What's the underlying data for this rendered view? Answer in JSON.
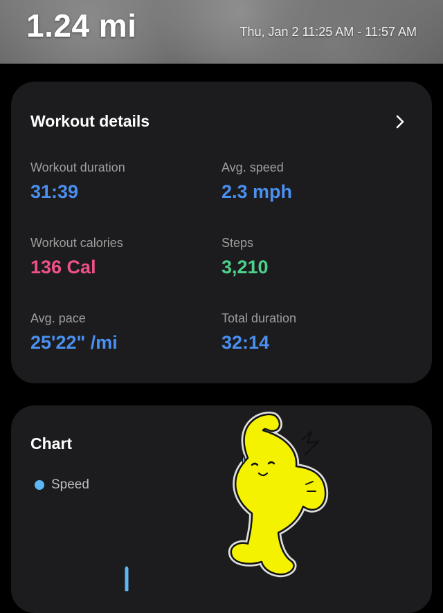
{
  "header": {
    "distance": "1.24 mi",
    "datetime": "Thu, Jan 2 11:25 AM - 11:57 AM"
  },
  "details": {
    "title": "Workout details",
    "chevron_icon": "chevron-right-icon",
    "stats": [
      {
        "label": "Workout duration",
        "value": "31:39",
        "color": "#4a90f0"
      },
      {
        "label": "Avg. speed",
        "value": "2.3 mph",
        "color": "#4a90f0"
      },
      {
        "label": "Workout calories",
        "value": "136 Cal",
        "color": "#f0508a"
      },
      {
        "label": "Steps",
        "value": "3,210",
        "color": "#4cd08a"
      },
      {
        "label": "Avg. pace",
        "value": "25'22\" /mi",
        "color": "#4a90f0"
      },
      {
        "label": "Total duration",
        "value": "32:14",
        "color": "#4a90f0"
      }
    ]
  },
  "chart": {
    "title": "Chart",
    "legend": [
      {
        "label": "Speed",
        "color": "#5bb8f5"
      }
    ]
  },
  "colors": {
    "background": "#000000",
    "card": "#1c1c1e",
    "label_gray": "#9e9e9e",
    "sticker_yellow": "#f5f200"
  },
  "sticker": {
    "icon": "yellow-cartoon-sticker-icon"
  }
}
